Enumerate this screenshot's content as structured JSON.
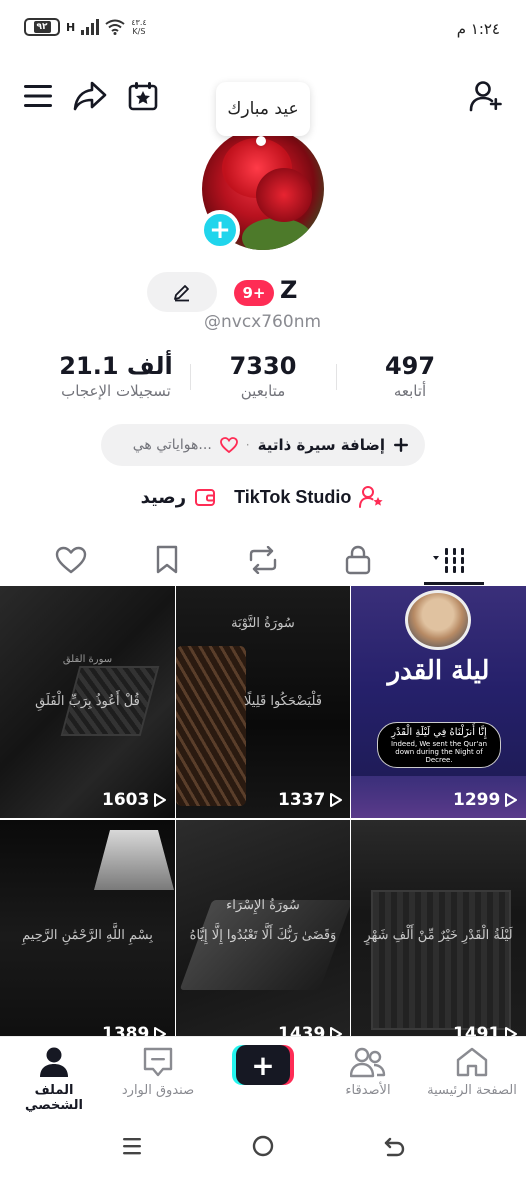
{
  "status_bar": {
    "time": "١:٢٤ م",
    "battery": "٩٢",
    "network_type": "H",
    "speed_value": "٤٣.٤",
    "speed_unit": "K/S"
  },
  "profile": {
    "greeting": "عيد مبارك",
    "display_name": "Z",
    "notification_badge": "9+",
    "username": "@nvcx760nm",
    "stats": {
      "following": {
        "value": "497",
        "label": "أتابعه"
      },
      "followers": {
        "value": "7330",
        "label": "متابعين"
      },
      "likes": {
        "value": "21.1 ألف",
        "label": "تسجيلات الإعجاب"
      }
    },
    "bio": {
      "add_label": "إضافة سيرة ذاتية",
      "separator": "·",
      "hobbies_label": "هواياتي هي..."
    },
    "links": {
      "studio_label": "TikTok Studio",
      "balance_label": "رصيد"
    }
  },
  "tabs": [
    "videos",
    "private",
    "reposts",
    "favorites",
    "liked"
  ],
  "videos": [
    {
      "views": "1603",
      "caption": "قُلْ أَعُوذُ بِرَبِّ الْفَلَقِ",
      "surah": "سورة الفلق"
    },
    {
      "views": "1337",
      "caption": "فَلْيَضْحَكُوا قَلِيلًا",
      "surah": "سُورَةُ التَّوْبَة"
    },
    {
      "views": "1299",
      "caption": "إِنَّا أَنزَلْنَاهُ فِي لَيْلَةِ الْقَدْرِ",
      "title": "ليلة القدر",
      "translation": "Indeed, We sent the Qur'an down during the Night of Decree."
    },
    {
      "views": "1389",
      "caption": "بِسْمِ اللَّهِ الرَّحْمَٰنِ الرَّحِيمِ",
      "surah": ""
    },
    {
      "views": "1439",
      "caption": "وَقَضَىٰ رَبُّكَ أَلَّا تَعْبُدُوا إِلَّا إِيَّاهُ",
      "surah": "سُورَةُ الإِسْرَاء"
    },
    {
      "views": "1491",
      "caption": "لَيْلَةُ الْقَدْرِ خَيْرٌ مِّنْ أَلْفِ شَهْرٍ",
      "surah": ""
    }
  ],
  "bottom_nav": {
    "home": "الصفحة الرئيسية",
    "friends": "الأصدقاء",
    "inbox": "صندوق الوارد",
    "profile": "الملف الشخصي"
  },
  "colors": {
    "accent_red": "#fe2c55",
    "accent_cyan": "#25f4ee",
    "add_button": "#20d5ec",
    "text_primary": "#161823",
    "text_secondary": "#8a8b91"
  }
}
